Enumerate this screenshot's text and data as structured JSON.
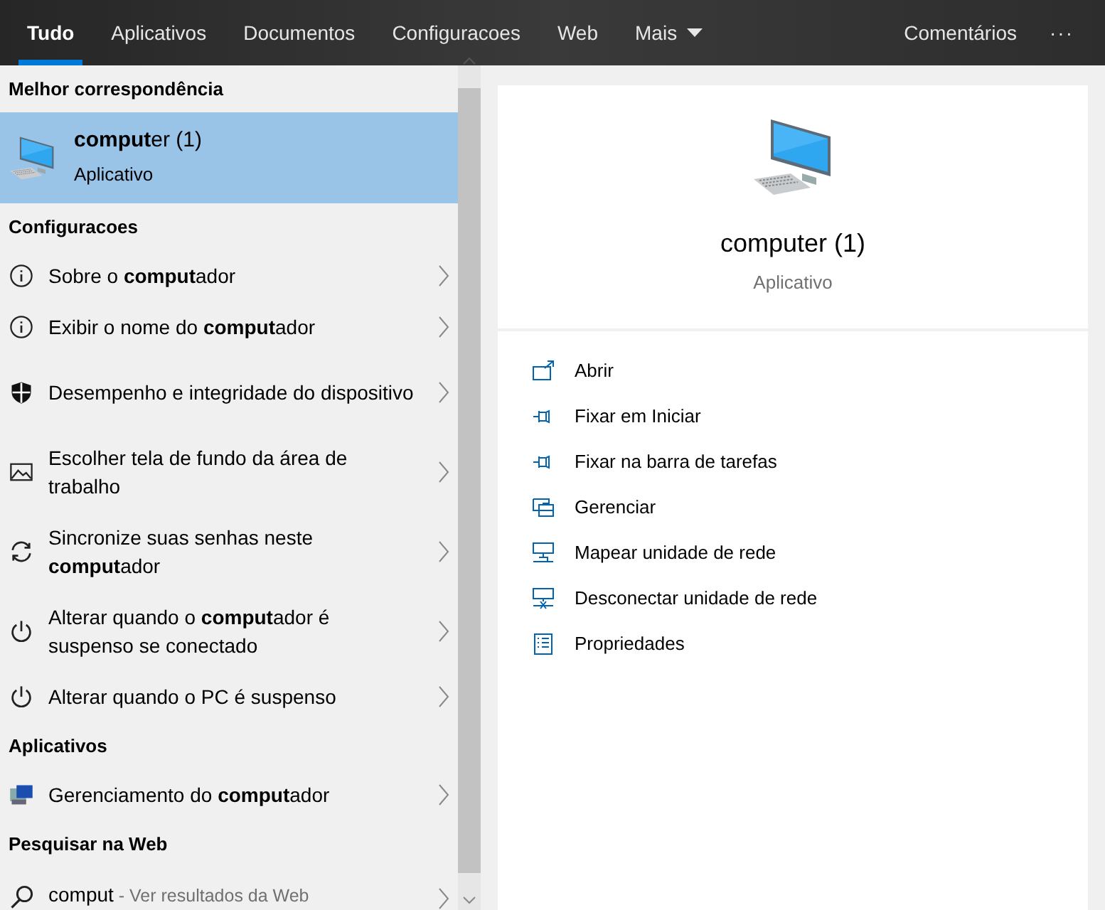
{
  "tabs": [
    {
      "label": "Tudo",
      "selected": true,
      "kind": "tab"
    },
    {
      "label": "Aplicativos",
      "selected": false,
      "kind": "tab"
    },
    {
      "label": "Documentos",
      "selected": false,
      "kind": "tab"
    },
    {
      "label": "Configuracoes",
      "selected": false,
      "kind": "tab"
    },
    {
      "label": "Web",
      "selected": false,
      "kind": "tab"
    },
    {
      "label": "Mais",
      "selected": false,
      "kind": "dropdown"
    }
  ],
  "toolbar": {
    "feedback": "Comentários",
    "more": "···"
  },
  "results": [
    {
      "kind": "header",
      "label": "Melhor correspondência"
    },
    {
      "kind": "best",
      "title": "**comput**er (1)",
      "subtitle": "Aplicativo",
      "selected": true
    },
    {
      "kind": "header",
      "label": "Configuracoes"
    },
    {
      "kind": "info",
      "label": "Sobre o **comput**ador",
      "selected": false
    },
    {
      "kind": "info",
      "label": "Exibir o nome do **comput**ador",
      "selected": false
    },
    {
      "kind": "shield",
      "label": "Desempenho e integridade do dispositivo",
      "selected": false
    },
    {
      "kind": "image",
      "label": "Escolher tela de fundo da área de trabalho",
      "selected": false
    },
    {
      "kind": "sync",
      "label": "Sincronize suas senhas neste **comput**ador",
      "selected": false
    },
    {
      "kind": "power",
      "label": "Alterar quando o **comput**ador é suspenso se conectado",
      "selected": false
    },
    {
      "kind": "power",
      "label": "Alterar quando o PC é suspenso",
      "selected": false
    },
    {
      "kind": "header",
      "label": "Aplicativos"
    },
    {
      "kind": "app",
      "label": "Gerenciamento do **comput**ador",
      "selected": false
    },
    {
      "kind": "header",
      "label": "Pesquisar na Web"
    },
    {
      "kind": "web",
      "query": "comput",
      "hint": "- Ver resultados da Web",
      "selected": false
    }
  ],
  "preview": {
    "title": "computer (1)",
    "subtitle": "Aplicativo",
    "actions": [
      {
        "kind": "open",
        "label": "Abrir"
      },
      {
        "kind": "pin",
        "label": "Fixar em Iniciar"
      },
      {
        "kind": "pin",
        "label": "Fixar na barra de tarefas"
      },
      {
        "kind": "manage",
        "label": "Gerenciar"
      },
      {
        "kind": "map",
        "label": "Mapear unidade de rede"
      },
      {
        "kind": "disconnect",
        "label": "Desconectar unidade de rede"
      },
      {
        "kind": "properties",
        "label": "Propriedades"
      }
    ]
  }
}
